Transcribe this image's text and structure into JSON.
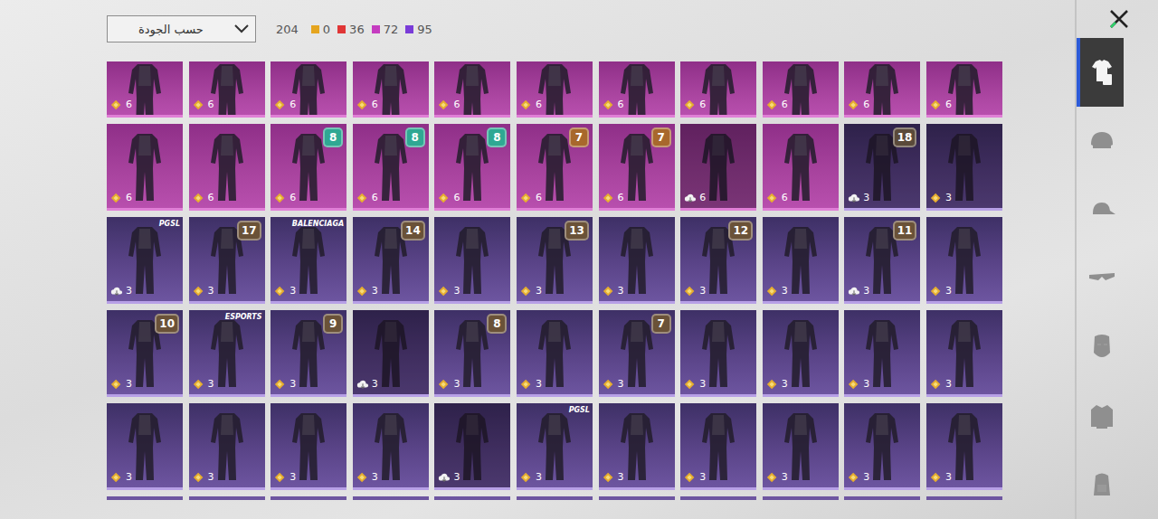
{
  "filter": {
    "label": "حسب الجودة"
  },
  "total": "204",
  "counts": [
    {
      "value": "0",
      "color": "#e5a51f"
    },
    {
      "value": "36",
      "color": "#e03636"
    },
    {
      "value": "72",
      "color": "#c53cc0"
    },
    {
      "value": "95",
      "color": "#7a3cd8"
    }
  ],
  "grid": {
    "rows": [
      [
        {
          "rarity": "legendary",
          "dark": false,
          "currency": "coin",
          "value": "6"
        },
        {
          "rarity": "legendary",
          "dark": false,
          "currency": "coin",
          "value": "6"
        },
        {
          "rarity": "legendary",
          "dark": false,
          "currency": "coin",
          "value": "6"
        },
        {
          "rarity": "legendary",
          "dark": false,
          "currency": "coin",
          "value": "6"
        },
        {
          "rarity": "legendary",
          "dark": false,
          "currency": "coin",
          "value": "6"
        },
        {
          "rarity": "legendary",
          "dark": false,
          "currency": "coin",
          "value": "6"
        },
        {
          "rarity": "legendary",
          "dark": false,
          "currency": "coin",
          "value": "6"
        },
        {
          "rarity": "legendary",
          "dark": false,
          "currency": "coin",
          "value": "6"
        },
        {
          "rarity": "legendary",
          "dark": false,
          "currency": "coin",
          "value": "6"
        },
        {
          "rarity": "legendary",
          "dark": false,
          "currency": "coin",
          "value": "6"
        },
        {
          "rarity": "legendary",
          "dark": false,
          "currency": "coin",
          "value": "6"
        }
      ],
      [
        {
          "rarity": "legendary",
          "dark": false,
          "currency": "coin",
          "value": "6"
        },
        {
          "rarity": "legendary",
          "dark": false,
          "currency": "coin",
          "value": "6"
        },
        {
          "rarity": "legendary",
          "dark": false,
          "currency": "coin",
          "value": "6",
          "badge": {
            "text": "8",
            "color": "#2fa893"
          }
        },
        {
          "rarity": "legendary",
          "dark": false,
          "currency": "coin",
          "value": "6",
          "badge": {
            "text": "8",
            "color": "#2fa893"
          }
        },
        {
          "rarity": "legendary",
          "dark": false,
          "currency": "coin",
          "value": "6",
          "badge": {
            "text": "8",
            "color": "#2fa893"
          }
        },
        {
          "rarity": "legendary",
          "dark": false,
          "currency": "coin",
          "value": "6",
          "badge": {
            "text": "7",
            "color": "#a8682c"
          }
        },
        {
          "rarity": "legendary",
          "dark": false,
          "currency": "coin",
          "value": "6",
          "badge": {
            "text": "7",
            "color": "#a8682c"
          }
        },
        {
          "rarity": "legendary",
          "dark": true,
          "currency": "cloud",
          "value": "6"
        },
        {
          "rarity": "legendary",
          "dark": false,
          "currency": "coin",
          "value": "6"
        },
        {
          "rarity": "epic",
          "dark": true,
          "currency": "cloud",
          "value": "3",
          "badge": {
            "text": "18",
            "color": "#5a4a3a"
          }
        },
        {
          "rarity": "epic",
          "dark": true,
          "currency": "coin",
          "value": "3"
        }
      ],
      [
        {
          "rarity": "epic",
          "dark": false,
          "currency": "cloud",
          "value": "3",
          "label": "PGSL"
        },
        {
          "rarity": "epic",
          "dark": false,
          "currency": "coin",
          "value": "3",
          "badge": {
            "text": "17",
            "color": "#6a5238"
          }
        },
        {
          "rarity": "epic",
          "dark": false,
          "currency": "coin",
          "value": "3",
          "label": "BALENCIAGA"
        },
        {
          "rarity": "epic",
          "dark": false,
          "currency": "coin",
          "value": "3",
          "badge": {
            "text": "14",
            "color": "#6a5238"
          }
        },
        {
          "rarity": "epic",
          "dark": false,
          "currency": "coin",
          "value": "3"
        },
        {
          "rarity": "epic",
          "dark": false,
          "currency": "coin",
          "value": "3",
          "badge": {
            "text": "13",
            "color": "#6a5238"
          }
        },
        {
          "rarity": "epic",
          "dark": false,
          "currency": "coin",
          "value": "3"
        },
        {
          "rarity": "epic",
          "dark": false,
          "currency": "coin",
          "value": "3",
          "badge": {
            "text": "12",
            "color": "#6a5238"
          }
        },
        {
          "rarity": "epic",
          "dark": false,
          "currency": "coin",
          "value": "3"
        },
        {
          "rarity": "epic",
          "dark": false,
          "currency": "cloud",
          "value": "3",
          "badge": {
            "text": "11",
            "color": "#6a5238"
          }
        },
        {
          "rarity": "epic",
          "dark": false,
          "currency": "coin",
          "value": "3"
        }
      ],
      [
        {
          "rarity": "epic",
          "dark": false,
          "currency": "coin",
          "value": "3",
          "badge": {
            "text": "10",
            "color": "#6a5238"
          }
        },
        {
          "rarity": "epic",
          "dark": false,
          "currency": "coin",
          "value": "3",
          "label": "ESPORTS"
        },
        {
          "rarity": "epic",
          "dark": false,
          "currency": "coin",
          "value": "3",
          "badge": {
            "text": "9",
            "color": "#6a5238"
          }
        },
        {
          "rarity": "epic",
          "dark": true,
          "currency": "cloud",
          "value": "3"
        },
        {
          "rarity": "epic",
          "dark": false,
          "currency": "coin",
          "value": "3",
          "badge": {
            "text": "8",
            "color": "#6a5238"
          }
        },
        {
          "rarity": "epic",
          "dark": false,
          "currency": "coin",
          "value": "3"
        },
        {
          "rarity": "epic",
          "dark": false,
          "currency": "coin",
          "value": "3",
          "badge": {
            "text": "7",
            "color": "#6a5238"
          }
        },
        {
          "rarity": "epic",
          "dark": false,
          "currency": "coin",
          "value": "3"
        },
        {
          "rarity": "epic",
          "dark": false,
          "currency": "coin",
          "value": "3"
        },
        {
          "rarity": "epic",
          "dark": false,
          "currency": "coin",
          "value": "3"
        },
        {
          "rarity": "epic",
          "dark": false,
          "currency": "coin",
          "value": "3"
        }
      ],
      [
        {
          "rarity": "epic",
          "dark": false,
          "currency": "coin",
          "value": "3"
        },
        {
          "rarity": "epic",
          "dark": false,
          "currency": "coin",
          "value": "3"
        },
        {
          "rarity": "epic",
          "dark": false,
          "currency": "coin",
          "value": "3"
        },
        {
          "rarity": "epic",
          "dark": false,
          "currency": "coin",
          "value": "3"
        },
        {
          "rarity": "epic",
          "dark": true,
          "currency": "cloud",
          "value": "3"
        },
        {
          "rarity": "epic",
          "dark": false,
          "currency": "coin",
          "value": "3",
          "label": "PGSL"
        },
        {
          "rarity": "epic",
          "dark": false,
          "currency": "coin",
          "value": "3"
        },
        {
          "rarity": "epic",
          "dark": false,
          "currency": "coin",
          "value": "3"
        },
        {
          "rarity": "epic",
          "dark": false,
          "currency": "coin",
          "value": "3"
        },
        {
          "rarity": "epic",
          "dark": false,
          "currency": "coin",
          "value": "3"
        },
        {
          "rarity": "epic",
          "dark": false,
          "currency": "coin",
          "value": "3"
        }
      ]
    ]
  },
  "sidebar": {
    "items": [
      {
        "kind": "outfit",
        "selected": true
      },
      {
        "kind": "helmet",
        "selected": false
      },
      {
        "kind": "cap",
        "selected": false
      },
      {
        "kind": "glasses",
        "selected": false
      },
      {
        "kind": "mask",
        "selected": false
      },
      {
        "kind": "jacket",
        "selected": false
      },
      {
        "kind": "backpack",
        "selected": false
      }
    ]
  }
}
